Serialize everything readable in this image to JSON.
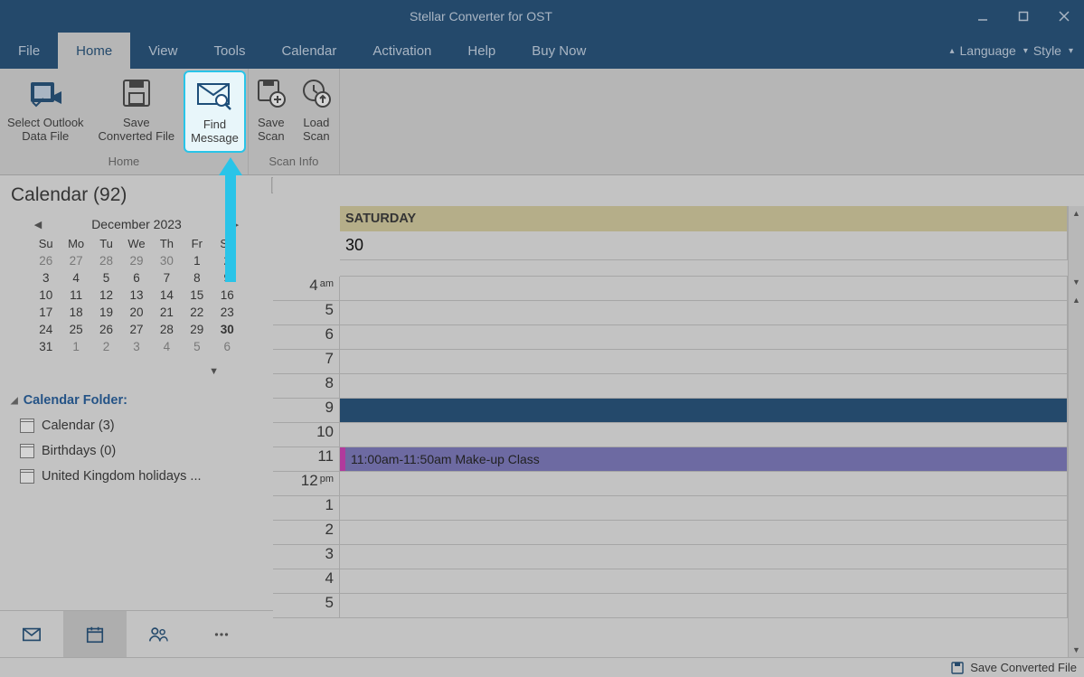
{
  "title": "Stellar Converter for OST",
  "menu": {
    "file": "File",
    "home": "Home",
    "view": "View",
    "tools": "Tools",
    "calendar": "Calendar",
    "activation": "Activation",
    "help": "Help",
    "buy_now": "Buy Now",
    "language": "Language",
    "style": "Style"
  },
  "ribbon": {
    "home_group": "Home",
    "scan_group": "Scan Info",
    "select_outlook_l1": "Select Outlook",
    "select_outlook_l2": "Data File",
    "save_converted_l1": "Save",
    "save_converted_l2": "Converted File",
    "find_message_l1": "Find",
    "find_message_l2": "Message",
    "save_scan_l1": "Save",
    "save_scan_l2": "Scan",
    "load_scan_l1": "Load",
    "load_scan_l2": "Scan"
  },
  "sidebar": {
    "title": "Calendar (92)",
    "month_label": "December 2023",
    "wd": [
      "Su",
      "Mo",
      "Tu",
      "We",
      "Th",
      "Fr",
      "Sa"
    ],
    "weeks": [
      [
        "26",
        "27",
        "28",
        "29",
        "30",
        "1",
        "2"
      ],
      [
        "3",
        "4",
        "5",
        "6",
        "7",
        "8",
        "9"
      ],
      [
        "10",
        "11",
        "12",
        "13",
        "14",
        "15",
        "16"
      ],
      [
        "17",
        "18",
        "19",
        "20",
        "21",
        "22",
        "23"
      ],
      [
        "24",
        "25",
        "26",
        "27",
        "28",
        "29",
        "30"
      ],
      [
        "31",
        "1",
        "2",
        "3",
        "4",
        "5",
        "6"
      ]
    ],
    "folder_header": "Calendar Folder:",
    "folders": {
      "calendar": "Calendar (3)",
      "birthdays": "Birthdays (0)",
      "uk": "United Kingdom holidays ..."
    }
  },
  "calendar_view": {
    "day_name": "SATURDAY",
    "day_num": "30",
    "hours": [
      "4",
      "5",
      "6",
      "7",
      "8",
      "9",
      "10",
      "11",
      "12",
      "1",
      "2",
      "3",
      "4",
      "5"
    ],
    "am_label": "am",
    "pm_label": "pm",
    "event_text": "11:00am-11:50am Make-up Class"
  },
  "statusbar": {
    "save": "Save Converted File"
  }
}
